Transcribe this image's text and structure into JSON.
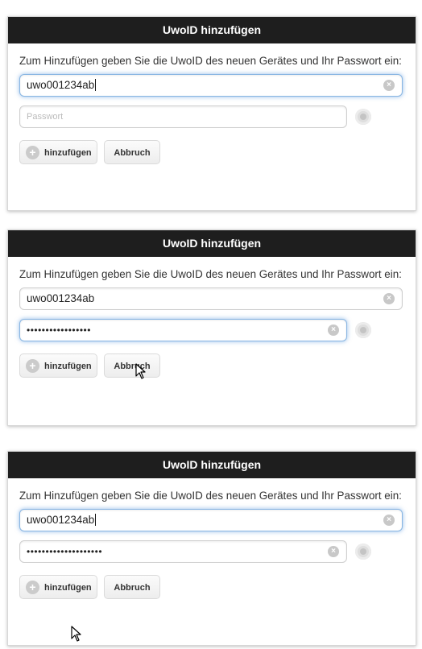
{
  "dialogs": [
    {
      "title": "UwoID hinzufügen",
      "message": "Zum Hinzufügen geben Sie die UwoID des neuen Gerätes und Ihr Passwort ein:",
      "uwoid_value": "uwo001234ab",
      "password_placeholder": "Passwort",
      "password_value": "",
      "add_label": "hinzufügen",
      "cancel_label": "Abbruch"
    },
    {
      "title": "UwoID hinzufügen",
      "message": "Zum Hinzufügen geben Sie die UwoID des neuen Gerätes und Ihr Passwort ein:",
      "uwoid_value": "uwo001234ab",
      "password_value": "•••••••••••••••••",
      "add_label": "hinzufügen",
      "cancel_label": "Abbruch"
    },
    {
      "title": "UwoID hinzufügen",
      "message": "Zum Hinzufügen geben Sie die UwoID des neuen Gerätes und Ihr Passwort ein:",
      "uwoid_value": "uwo001234ab",
      "password_value": "••••••••••••••••••••",
      "add_label": "hinzufügen",
      "cancel_label": "Abbruch"
    }
  ],
  "icons": {
    "clear": "clear-icon",
    "add": "plus-circle-icon",
    "toggle": "eye-icon",
    "pointer": "mouse-pointer-icon"
  },
  "colors": {
    "titlebar_bg": "#1e1e1e",
    "focus_glow": "#3884d6"
  }
}
